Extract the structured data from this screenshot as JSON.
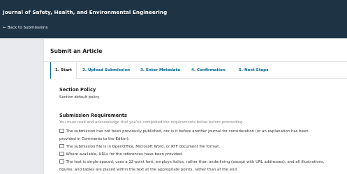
{
  "header": {
    "journal_title": "Journal of Safety, Health, and Environmental Engineering",
    "back_link": "Back to Submissions"
  },
  "page": {
    "title": "Submit an Article"
  },
  "tabs": [
    {
      "label": "1. Start",
      "active": true
    },
    {
      "label": "2. Upload Submission",
      "active": false
    },
    {
      "label": "3. Enter Metadata",
      "active": false
    },
    {
      "label": "4. Confirmation",
      "active": false
    },
    {
      "label": "5. Next Steps",
      "active": false
    }
  ],
  "section_policy": {
    "title": "Section Policy",
    "text": "Section default policy"
  },
  "requirements": {
    "title": "Submission Requirements",
    "instruction": "You must read and acknowledge that you've completed the requirements below before proceeding.",
    "items": [
      {
        "line1": "The submission has not been previously published, nor is it before another journal for consideration (or an explanation has been",
        "line2": "provided in Comments to the Editor).",
        "checked": false
      },
      {
        "line1": "The submission file is in OpenOffice, Microsoft Word, or RTF document file format.",
        "line2": "",
        "checked": false
      },
      {
        "line1": "Where available, URLs for the references have been provided.",
        "line2": "",
        "checked": false
      },
      {
        "line1": "The text is single-spaced; uses a 12-point font; employs italics, rather than underlining (except with URL addresses); and all illustrations,",
        "line2": "figures, and tables are placed within the text at the appropriate points, rather than at the end.",
        "checked": false
      }
    ]
  },
  "colors": {
    "header_bg": "#1e3445",
    "link": "#006798",
    "page_bg": "#e9eaed"
  }
}
